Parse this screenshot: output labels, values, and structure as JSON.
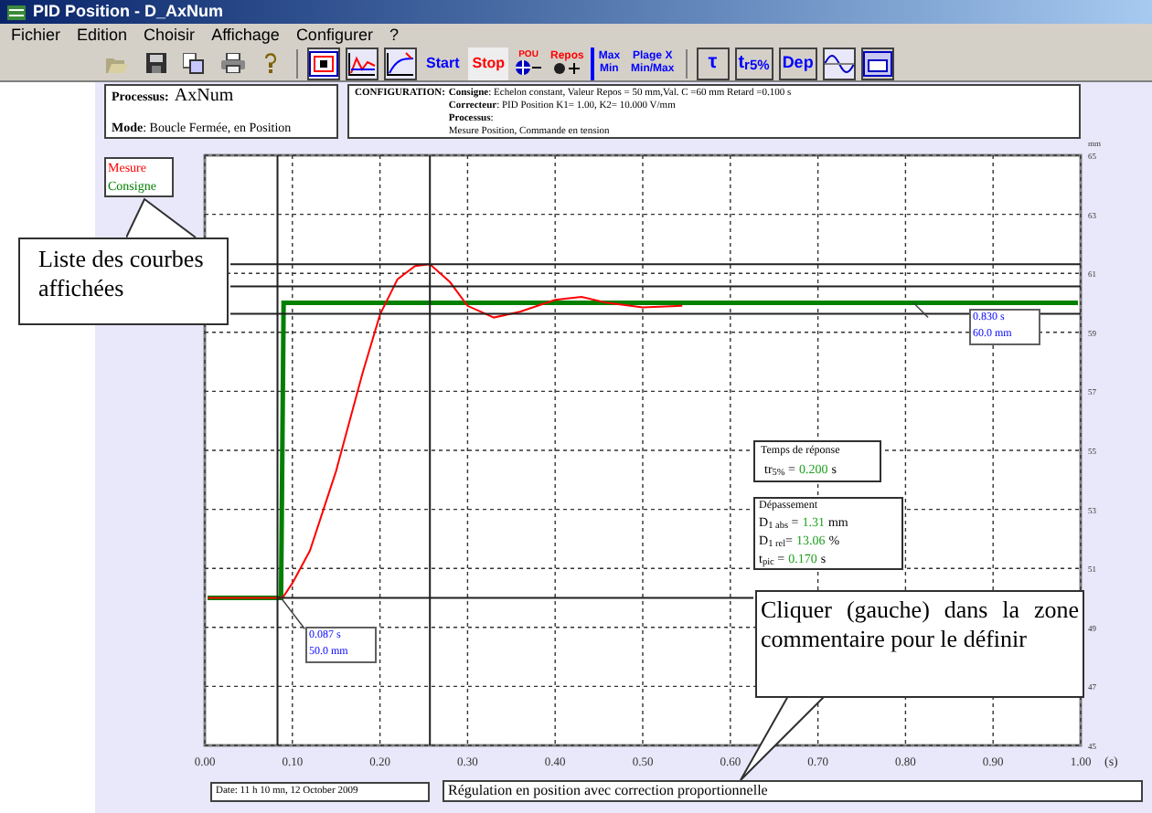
{
  "window": {
    "title": "PID Position - D_AxNum"
  },
  "menu": [
    "Fichier",
    "Edition",
    "Choisir",
    "Affichage",
    "Configurer",
    "?"
  ],
  "toolbar_buttons": [
    {
      "label": "Start",
      "color": "#0000ff"
    },
    {
      "label": "Stop",
      "color": "#ff0000"
    },
    {
      "label": "POU",
      "color": "#ff0000"
    },
    {
      "label": "Repos",
      "color": "#ff0000"
    },
    {
      "label": "Max",
      "sublabel": "Min",
      "color": "#0000ff"
    },
    {
      "label": "Plage X",
      "sublabel": "Min/Max",
      "color": "#0000ff"
    },
    {
      "label": "τ",
      "color": "#0000ff"
    },
    {
      "label": "t$_{r5%}$",
      "color": "#0000ff"
    },
    {
      "label": "Dep",
      "color": "#0000ff"
    }
  ],
  "process": {
    "label": "Processus:",
    "value": "AxNum",
    "mode": "**Mode**: Boucle Fermée, en Position"
  },
  "configuration": {
    "heading": "CONFIGURATION:",
    "lines": [
      "**Consigne**: Echelon constant, Valeur Repos = 50 mm,Val. C =60 mm Retard =0.100 s",
      "**Correcteur**: PID Position K1= 1.00, K2= 10.000 V/mm",
      "**Processus**:",
      "Mesure Position, Commande en tension"
    ]
  },
  "callouts": [
    {
      "text": "Liste des courbes affichées"
    },
    {
      "text": "Cliquer (gauche) dans la zone commentaire pour le définir"
    }
  ],
  "cursor_readouts": [
    {
      "time": "0.087 s",
      "value": "50.0 mm"
    },
    {
      "time": "0.830 s",
      "value": "60.0 mm"
    }
  ],
  "response_time": {
    "title": "Temps de réponse",
    "label": "tr$_{5%}$ =",
    "value": "0.200",
    "unit": "s"
  },
  "overshoot": {
    "title": "Dépassement",
    "rows": [
      {
        "label": "D$_{1 abs}$ =",
        "value": "1.31",
        "unit": "mm"
      },
      {
        "label": "D$_{1 rel}$=",
        "value": "13.06",
        "unit": "%"
      },
      {
        "label": "t$_{pic}$ =",
        "value": "0.170",
        "unit": "s"
      }
    ]
  },
  "chart": {
    "y_unit": "mm",
    "x_unit": "(s)",
    "chart_data": {
      "type": "line",
      "x": [
        0,
        0.087,
        0.09,
        0.1,
        0.12,
        0.15,
        0.18,
        0.2,
        0.22,
        0.24,
        0.257,
        0.28,
        0.3,
        0.33,
        0.36,
        0.4,
        0.43,
        0.46,
        0.5,
        0.545,
        1.0
      ],
      "series": [
        {
          "name": "Mesure",
          "color": "#ff0000",
          "values": [
            50,
            50,
            50.05,
            50.5,
            51.6,
            54.3,
            57.6,
            59.6,
            60.8,
            61.25,
            61.31,
            60.7,
            59.9,
            59.5,
            59.7,
            60.1,
            60.2,
            60.0,
            59.85,
            59.9,
            null
          ]
        },
        {
          "name": "Consigne",
          "color": "#008000",
          "values": [
            50,
            50,
            60,
            60,
            60,
            60,
            60,
            60,
            60,
            60,
            60,
            60,
            60,
            60,
            60,
            60,
            60,
            60,
            60,
            60,
            60
          ]
        }
      ],
      "xlim": [
        0,
        1
      ],
      "ylim": [
        45,
        65
      ],
      "grid": true,
      "xticks": [
        {
          "value": 0,
          "label": "0.00"
        },
        {
          "value": 0.1,
          "label": "0.10"
        },
        {
          "value": 0.2,
          "label": "0.20"
        },
        {
          "value": 0.3,
          "label": "0.30"
        },
        {
          "value": 0.4,
          "label": "0.40"
        },
        {
          "value": 0.5,
          "label": "0.50"
        },
        {
          "value": 0.6,
          "label": "0.60"
        },
        {
          "value": 0.7,
          "label": "0.70"
        },
        {
          "value": 0.8,
          "label": "0.80"
        },
        {
          "value": 0.9,
          "label": "0.90"
        },
        {
          "value": 1,
          "label": "1.00"
        }
      ],
      "yticks": [
        45,
        47,
        49,
        51,
        53,
        55,
        57,
        59,
        61,
        63,
        65
      ]
    }
  },
  "footer": {
    "date": "Date: 11 h 10 mn, 12 October 2009",
    "comment": "Régulation en position avec correction proportionnelle"
  }
}
